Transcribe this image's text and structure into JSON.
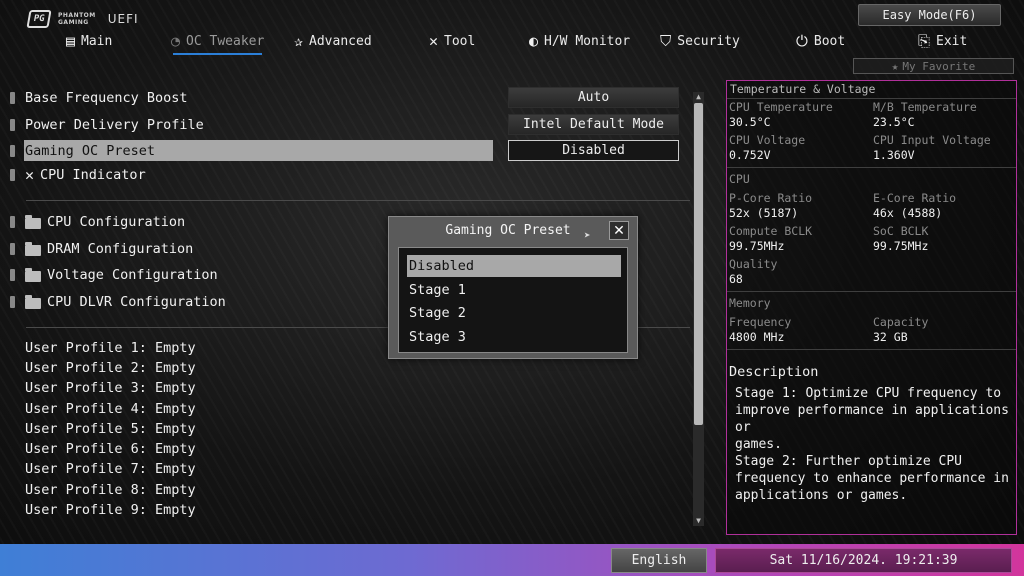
{
  "header": {
    "brand_line1": "PHANTOM",
    "brand_line2": "GAMING",
    "logo_mark": "PG",
    "uefi_label": "UEFI",
    "easy_mode_label": "Easy Mode(F6)",
    "favorite_label": "My Favorite",
    "favorite_icon": "star-icon"
  },
  "nav": {
    "tabs": [
      {
        "label": "Main",
        "icon": "grid-list-icon",
        "glyph": "▤"
      },
      {
        "label": "OC Tweaker",
        "icon": "dial-icon",
        "glyph": "◔",
        "active": true
      },
      {
        "label": "Advanced",
        "icon": "star-arrow-icon",
        "glyph": "✰"
      },
      {
        "label": "Tool",
        "icon": "wrench-screwdriver-icon",
        "glyph": "✕"
      },
      {
        "label": "H/W Monitor",
        "icon": "gauge-icon",
        "glyph": "◐"
      },
      {
        "label": "Security",
        "icon": "shield-icon",
        "glyph": "⛉"
      },
      {
        "label": "Boot",
        "icon": "power-icon",
        "glyph": "⏻"
      },
      {
        "label": "Exit",
        "icon": "exit-door-icon",
        "glyph": "⎘"
      }
    ]
  },
  "settings": [
    {
      "label": "Base Frequency Boost",
      "value": "Auto"
    },
    {
      "label": "Power Delivery Profile",
      "value": "Intel Default Mode"
    },
    {
      "label": "Gaming OC Preset",
      "value": "Disabled",
      "selected": true
    },
    {
      "label": "CPU Indicator"
    }
  ],
  "folders": [
    {
      "label": "CPU Configuration"
    },
    {
      "label": "DRAM Configuration"
    },
    {
      "label": "Voltage Configuration"
    },
    {
      "label": "CPU DLVR Configuration"
    }
  ],
  "profiles": [
    "User Profile 1: Empty",
    "User Profile 2: Empty",
    "User Profile 3: Empty",
    "User Profile 4: Empty",
    "User Profile 5: Empty",
    "User Profile 6: Empty",
    "User Profile 7: Empty",
    "User Profile 8: Empty",
    "User Profile 9: Empty"
  ],
  "dialog": {
    "title": "Gaming OC Preset",
    "close_glyph": "✕",
    "options": [
      "Disabled",
      "Stage 1",
      "Stage 2",
      "Stage 3"
    ],
    "selected_index": 0
  },
  "monitor": {
    "section_title": "Temperature & Voltage",
    "cpu_temp_label": "CPU Temperature",
    "cpu_temp": "30.5°C",
    "mb_temp_label": "M/B Temperature",
    "mb_temp": "23.5°C",
    "cpu_voltage_label": "CPU Voltage",
    "cpu_voltage": "0.752V",
    "cpu_input_voltage_label": "CPU Input Voltage",
    "cpu_input_voltage": "1.360V",
    "cpu_section": "CPU",
    "pcore_label": "P-Core Ratio",
    "pcore": "52x (5187)",
    "ecore_label": "E-Core Ratio",
    "ecore": "46x (4588)",
    "compute_bclk_label": "Compute BCLK",
    "compute_bclk": "99.75MHz",
    "soc_bclk_label": "SoC BCLK",
    "soc_bclk": "99.75MHz",
    "quality_label": "Quality",
    "quality": "68",
    "memory_section": "Memory",
    "frequency_label": "Frequency",
    "frequency": "4800 MHz",
    "capacity_label": "Capacity",
    "capacity": "32 GB"
  },
  "description": {
    "title": "Description",
    "text": "Stage 1: Optimize CPU frequency to\nimprove performance in applications or\ngames.\nStage 2: Further optimize CPU\nfrequency to enhance performance in\napplications or games."
  },
  "footer": {
    "language": "English",
    "datetime": "Sat 11/16/2024. 19:21:39"
  },
  "colors": {
    "accent_blue": "#2b7fd8",
    "panel_border": "#b0309a",
    "selection": "#a8a8a8"
  }
}
